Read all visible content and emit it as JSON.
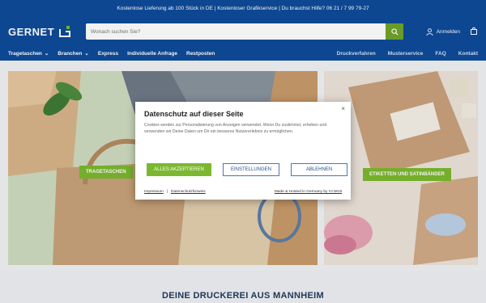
{
  "topbar": {
    "text": "Kostenlose Lieferung ab 100 Stück in DE | Kostenloser Grafikservice | Du brauchst Hilfe? 06 21 / 7 99 79-27"
  },
  "header": {
    "logo": "GERNET",
    "search_placeholder": "Wonach suchen Sie?",
    "account_label": "Anmelden"
  },
  "nav": {
    "left": [
      {
        "label": "Tragetaschen",
        "dropdown": true
      },
      {
        "label": "Branchen",
        "dropdown": true
      },
      {
        "label": "Express",
        "dropdown": false
      },
      {
        "label": "Individuelle Anfrage",
        "dropdown": false
      },
      {
        "label": "Restposten",
        "dropdown": false
      }
    ],
    "right": [
      "Druckverfahren",
      "Musterservice",
      "FAQ",
      "Kontakt"
    ]
  },
  "hero": {
    "left_cta": "TRAGETASCHEN",
    "right_cta": "ETIKETTEN UND SATINBÄNDER"
  },
  "section_title": "DEINE DRUCKEREI AUS MANNHEIM",
  "modal": {
    "title": "Datenschutz auf dieser Seite",
    "text": "Cookies werden zur Personalisierung von Anzeigen verwendet. Wenn Du zustimmst, erheben und verwenden wir Deine Daten um Dir ein besseres Nutzererlebnis zu ermöglichen.",
    "btn_accept": "ALLES AKZEPTIEREN",
    "btn_settings": "EINSTELLUNGEN",
    "btn_decline": "ABLEHNEN",
    "link_impressum": "Impressum",
    "link_privacy": "Datenschutzhinweis",
    "hosted": "Made & Hosted in Germany by CCM19",
    "close": "×"
  },
  "colors": {
    "brand": "#0e4b9a",
    "accent": "#7cb82f"
  }
}
